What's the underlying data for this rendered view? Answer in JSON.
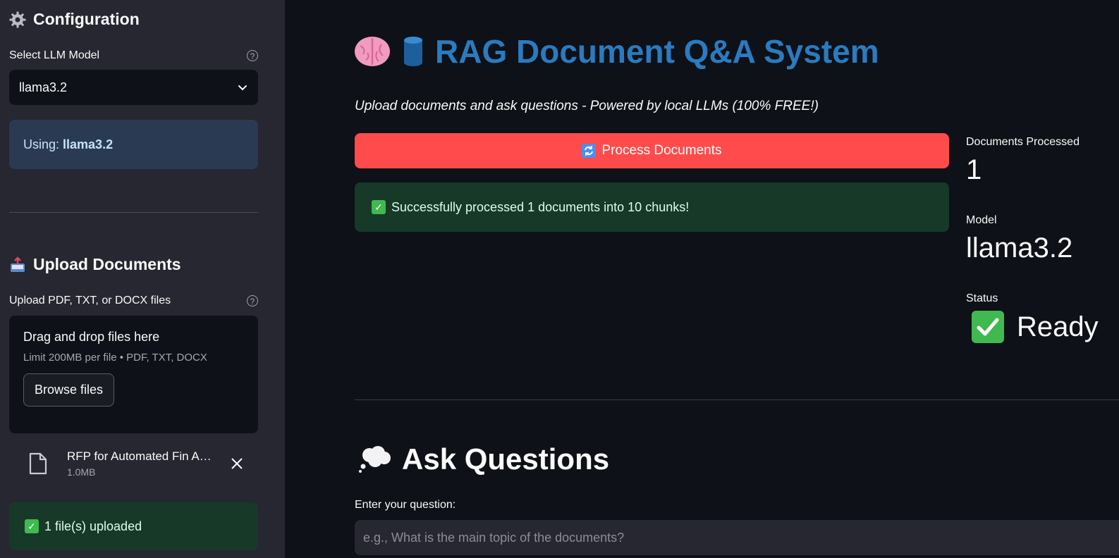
{
  "sidebar": {
    "config_title": "Configuration",
    "config_icon": "gear-icon",
    "model_label": "Select LLM Model",
    "model_value": "llama3.2",
    "using_prefix": "Using: ",
    "using_model": "llama3.2",
    "upload_title": "Upload Documents",
    "upload_icon": "inbox-tray-icon",
    "upload_label": "Upload PDF, TXT, or DOCX files",
    "drop_title": "Drag and drop files here",
    "drop_limit": "Limit 200MB per file • PDF, TXT, DOCX",
    "browse_label": "Browse files",
    "file": {
      "name": "RFP for Automated Fin A…",
      "size": "1.0MB"
    },
    "uploaded_status": "1 file(s) uploaded"
  },
  "main": {
    "title": "RAG Document Q&A System",
    "title_icons": [
      "brain-icon",
      "database-icon"
    ],
    "subtitle": "Upload documents and ask questions - Powered by local LLMs (100% FREE!)",
    "process_button": "Process Documents",
    "process_icon": "refresh-icon",
    "success_message": "Successfully processed 1 documents into 10 chunks!",
    "metrics": {
      "docs_label": "Documents Processed",
      "docs_value": "1",
      "model_label": "Model",
      "model_value": "llama3.2",
      "status_label": "Status",
      "status_value": "Ready"
    },
    "ask_title": "Ask Questions",
    "ask_icon": "thought-bubble-icon",
    "question_label": "Enter your question:",
    "question_placeholder": "e.g., What is the main topic of the documents?",
    "question_value": ""
  },
  "colors": {
    "background": "#0e1117",
    "sidebar": "#262730",
    "primary": "#ff4b4b",
    "title": "#2a7bbf",
    "success_bg": "#173928",
    "info_bg": "#2b3a53"
  }
}
